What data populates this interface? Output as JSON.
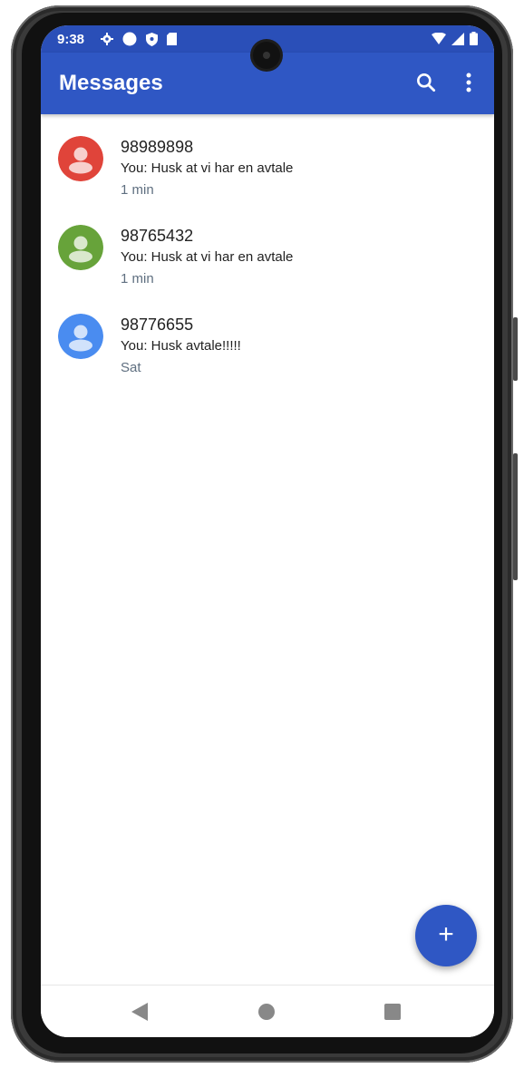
{
  "status_bar": {
    "time": "9:38",
    "icons_left": [
      "gear-icon",
      "circle-icon",
      "shield-icon",
      "sim-card-icon"
    ],
    "icons_right": [
      "wifi-icon",
      "signal-icon",
      "battery-icon"
    ]
  },
  "app_bar": {
    "title": "Messages",
    "actions": [
      "search-icon",
      "more-vert-icon"
    ]
  },
  "conversations": [
    {
      "name": "98989898",
      "snippet": "You: Husk at vi har en avtale",
      "time": "1 min",
      "avatar_color": "#e0443a"
    },
    {
      "name": "98765432",
      "snippet": "You: Husk at vi har en avtale",
      "time": "1 min",
      "avatar_color": "#67a33a"
    },
    {
      "name": "98776655",
      "snippet": "You: Husk avtale!!!!!",
      "time": "Sat",
      "avatar_color": "#4a8cf0"
    }
  ],
  "fab": {
    "label": "+",
    "icon": "plus-icon"
  },
  "nav_bar": {
    "buttons": [
      "back-icon",
      "home-icon",
      "recents-icon"
    ]
  },
  "colors": {
    "status_bar": "#2a4fb8",
    "app_bar": "#2f57c4",
    "fab": "#2f57c4",
    "secondary_text": "#5f6f80"
  }
}
